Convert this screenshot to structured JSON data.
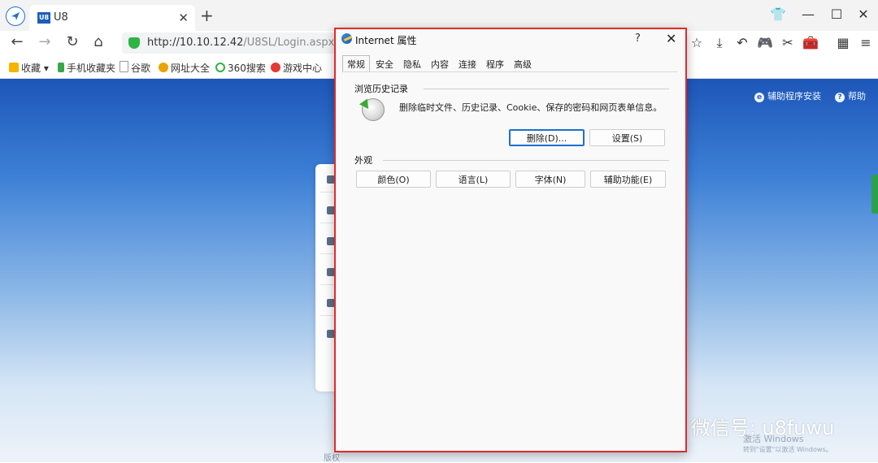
{
  "browser": {
    "tab_title": "U8",
    "tab_favicon": "U8",
    "url_host": "http://10.10.12.42",
    "url_path": "/U8SL/Login.aspx",
    "bookmarks": [
      {
        "label": "收藏",
        "icon": "star-icon"
      },
      {
        "label": "手机收藏夹",
        "icon": "phone-icon"
      },
      {
        "label": "谷歌",
        "icon": "page-icon"
      },
      {
        "label": "网址大全",
        "icon": "globe-icon"
      },
      {
        "label": "360搜索",
        "icon": "search-icon"
      },
      {
        "label": "游戏中心",
        "icon": "game-icon"
      }
    ]
  },
  "page": {
    "helper_install": "辅助程序安装",
    "help": "帮助",
    "footer_partial": "版权"
  },
  "dialog": {
    "title": "Internet 属性",
    "help_glyph": "?",
    "close_glyph": "✕",
    "tabs": [
      "常规",
      "安全",
      "隐私",
      "内容",
      "连接",
      "程序",
      "高级"
    ],
    "active_tab": "常规",
    "history_section": "浏览历史记录",
    "history_desc": "删除临时文件、历史记录、Cookie、保存的密码和网页表单信息。",
    "delete_button": "删除(D)...",
    "settings_button": "设置(S)",
    "appearance_section": "外观",
    "colors_button": "颜色(O)",
    "languages_button": "语言(L)",
    "fonts_button": "字体(N)",
    "accessibility_button": "辅助功能(E)"
  },
  "watermark": {
    "text": "微信号: u8fuwu",
    "activate_title": "激活 Windows",
    "activate_sub": "转到\"设置\"以激活 Windows。"
  },
  "colors": {
    "highlight_border": "#e02b2b",
    "default_button_border": "#1d6fce",
    "page_top": "#1d56b8"
  }
}
